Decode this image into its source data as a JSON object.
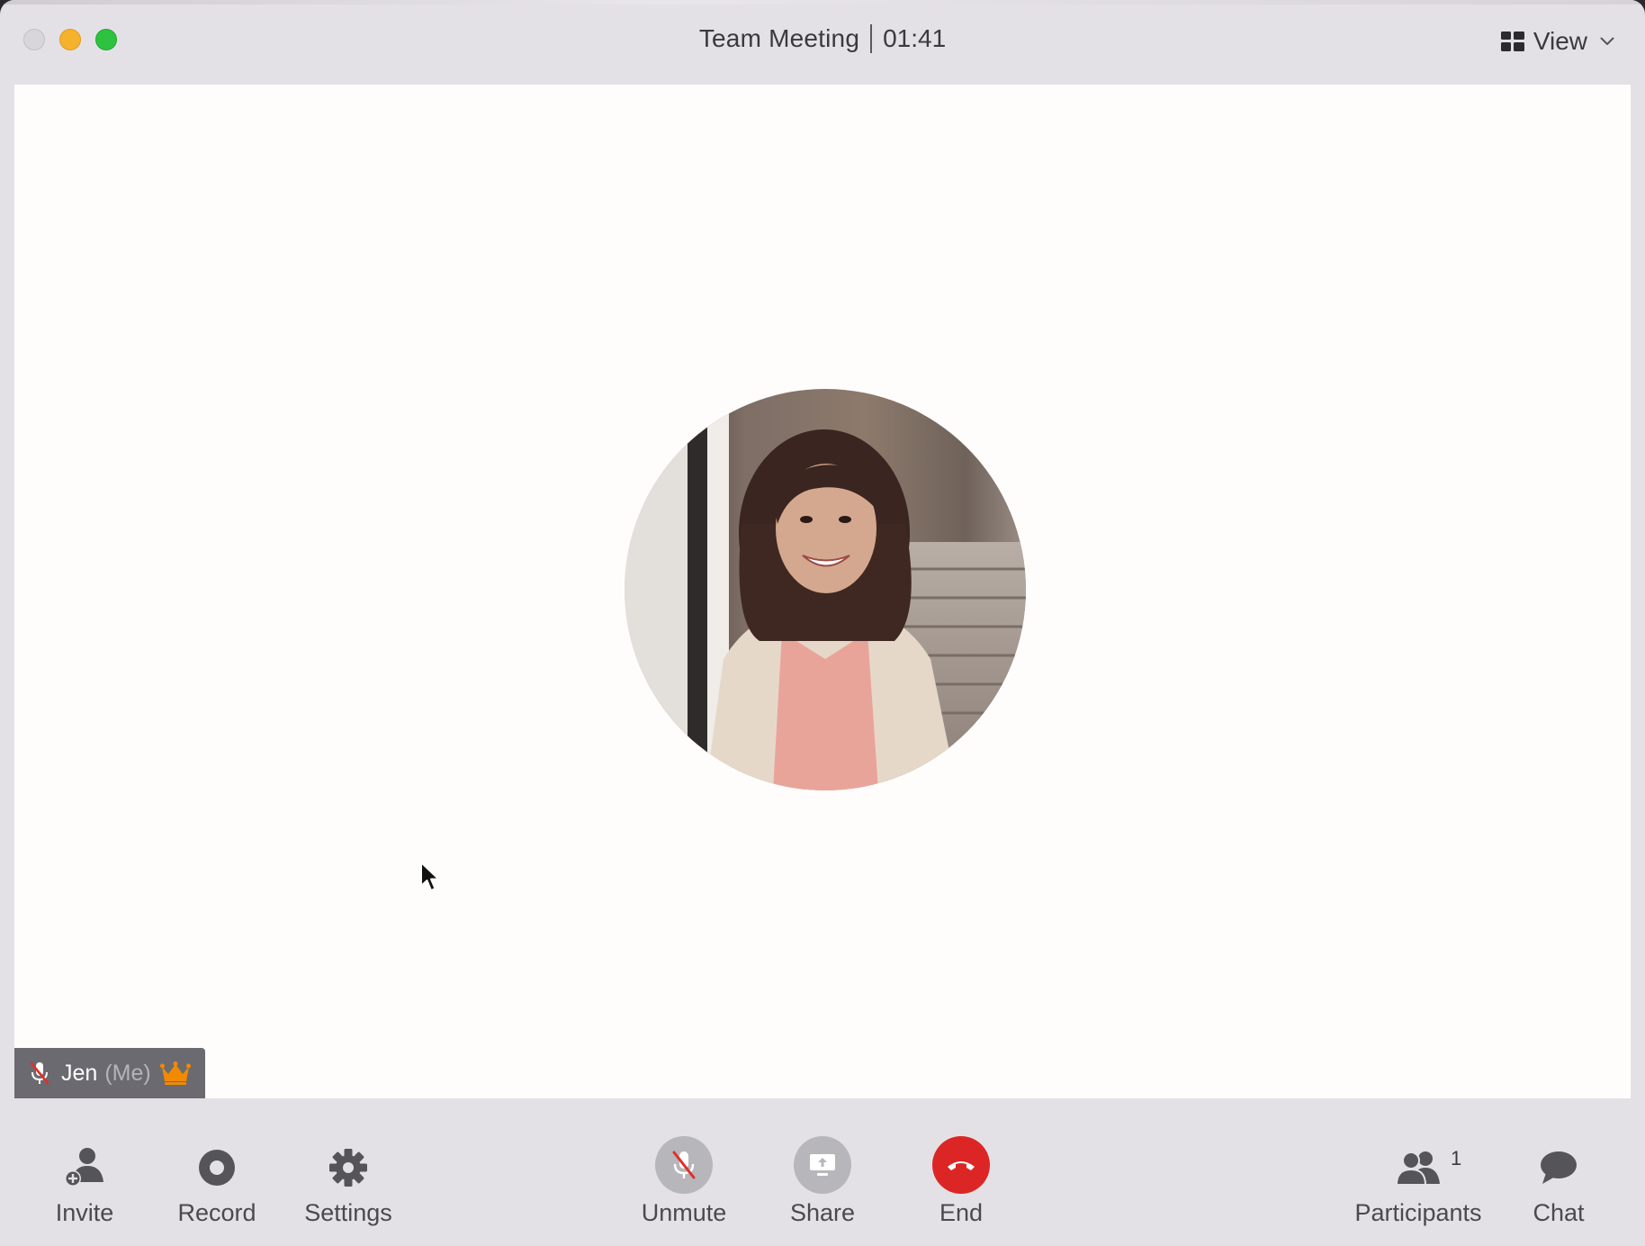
{
  "window": {
    "title": "Team Meeting",
    "timer": "01:41",
    "view_label": "View"
  },
  "video": {
    "participant_name": "Jen",
    "participant_suffix": "(Me)",
    "muted": true,
    "host": true
  },
  "toolbar": {
    "invite_label": "Invite",
    "record_label": "Record",
    "settings_label": "Settings",
    "unmute_label": "Unmute",
    "share_label": "Share",
    "end_label": "End",
    "participants_label": "Participants",
    "participants_count": "1",
    "chat_label": "Chat"
  },
  "colors": {
    "end_red": "#dc2626",
    "crown_orange": "#f28a00",
    "mute_slash_red": "#e0302b"
  }
}
